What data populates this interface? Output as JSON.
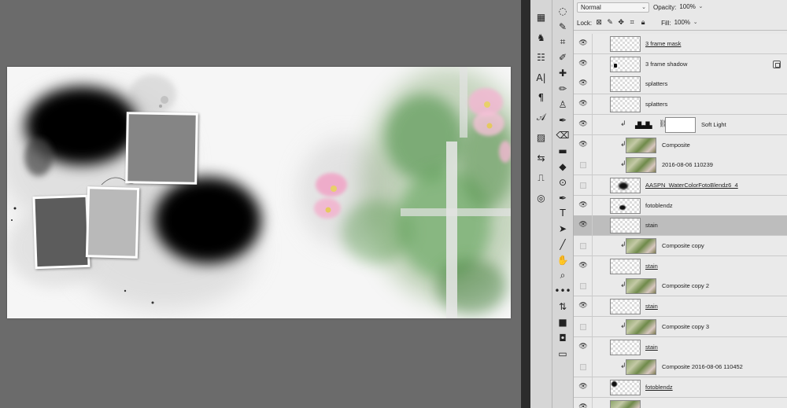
{
  "options_bar": {
    "blend_mode": "Normal",
    "opacity_label": "Opacity:",
    "opacity_value": "100%",
    "lock_label": "Lock:",
    "fill_label": "Fill:",
    "fill_value": "100%"
  },
  "colors": {
    "canvas_bg": "#6b6b6b",
    "panel_bg": "#e8e8e8",
    "selected_row": "#bdbdbd",
    "document_bg": "#f6f6f6"
  },
  "layers": [
    {
      "name": "3 frame mask",
      "visible": true,
      "clipped": false,
      "thumb": "transparent",
      "smart": true
    },
    {
      "name": "3 frame shadow",
      "visible": true,
      "clipped": false,
      "thumb": "shadow",
      "smart": false,
      "fx": true
    },
    {
      "name": "splatters",
      "visible": true,
      "clipped": false,
      "thumb": "transparent",
      "smart": false
    },
    {
      "name": "splatters",
      "visible": true,
      "clipped": false,
      "thumb": "transparent",
      "smart": false
    },
    {
      "name": "Soft Light",
      "visible": true,
      "clipped": true,
      "thumb": "adjustment",
      "smart": false,
      "mask": true
    },
    {
      "name": "Composite",
      "visible": true,
      "clipped": true,
      "thumb": "image",
      "smart": false
    },
    {
      "name": "2016-08-06 110239",
      "visible": false,
      "clipped": true,
      "thumb": "image",
      "smart": false
    },
    {
      "name": "AASPN_WaterColorFotoBlendz6_4",
      "visible": false,
      "clipped": false,
      "thumb": "blob",
      "smart": true
    },
    {
      "name": "fotoblendz",
      "visible": true,
      "clipped": false,
      "thumb": "blob-small",
      "smart": false
    },
    {
      "name": "stain",
      "visible": true,
      "clipped": false,
      "thumb": "transparent",
      "smart": false,
      "selected": true
    },
    {
      "name": "Composite copy",
      "visible": false,
      "clipped": true,
      "thumb": "image",
      "smart": false
    },
    {
      "name": "stain",
      "visible": true,
      "clipped": false,
      "thumb": "transparent",
      "smart": true
    },
    {
      "name": "Composite copy 2",
      "visible": false,
      "clipped": true,
      "thumb": "image",
      "smart": false
    },
    {
      "name": "stain",
      "visible": true,
      "clipped": false,
      "thumb": "transparent",
      "smart": true
    },
    {
      "name": "Composite copy 3",
      "visible": false,
      "clipped": true,
      "thumb": "image",
      "smart": false
    },
    {
      "name": "stain",
      "visible": true,
      "clipped": false,
      "thumb": "transparent",
      "smart": true
    },
    {
      "name": "Composite 2016-08-06 110452",
      "visible": false,
      "clipped": true,
      "thumb": "image",
      "smart": false
    },
    {
      "name": "fotoblendz",
      "visible": true,
      "clipped": false,
      "thumb": "blob-corner",
      "smart": true
    },
    {
      "name": "",
      "visible": true,
      "clipped": false,
      "thumb": "image",
      "smart": false
    }
  ],
  "tools": {
    "left_column": [
      "3d-materials-icon",
      "libraries-icon",
      "adjust-sliders-icon",
      "character-icon",
      "paragraph-icon",
      "glyphs-icon",
      "properties-icon",
      "paths-icon",
      "timeline-icon",
      "channels-icon"
    ],
    "right_column": [
      "lasso-icon",
      "quick-select-icon",
      "crop-icon",
      "eyedropper-icon",
      "healing-icon",
      "brush-icon",
      "stamp-icon",
      "history-brush-icon",
      "eraser-icon",
      "gradient-icon",
      "blur-icon",
      "dodge-icon",
      "pen-icon",
      "type-icon",
      "path-select-icon",
      "line-icon",
      "hand-icon",
      "zoom-icon",
      "more-icon",
      "swap-colors-icon",
      "color-swatches-icon",
      "quick-mask-icon",
      "screen-mode-icon"
    ]
  },
  "tool_glyphs": {
    "left_column": [
      "▦",
      "♞",
      "☷",
      "A|",
      "¶",
      "𝒜",
      "▨",
      "⇆",
      "⎍",
      "◎"
    ],
    "right_column": [
      "◌",
      "✎",
      "⌗",
      "✐",
      "✚",
      "✏",
      "♙",
      "✒",
      "⌫",
      "▬",
      "◆",
      "⊙",
      "✒",
      "T",
      "➤",
      "╱",
      "✋",
      "⌕",
      "•••",
      "⇅",
      "■",
      "◘",
      "▭"
    ]
  }
}
